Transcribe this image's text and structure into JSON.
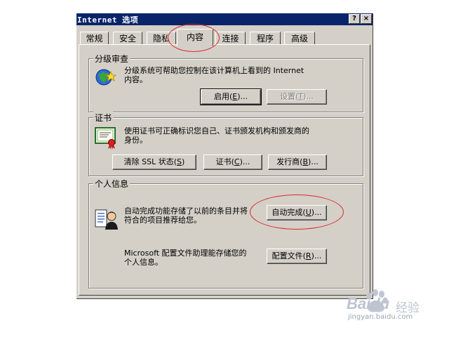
{
  "window": {
    "title": "Internet 选项",
    "help_btn": "?",
    "close_btn": "×"
  },
  "tabs": [
    {
      "label": "常规"
    },
    {
      "label": "安全"
    },
    {
      "label": "隐私"
    },
    {
      "label": "内容",
      "active": true
    },
    {
      "label": "连接"
    },
    {
      "label": "程序"
    },
    {
      "label": "高级"
    }
  ],
  "content_advisor": {
    "title": "分级审查",
    "description_line1": "分级系统可帮助您控制在该计算机上看到的 Internet",
    "description_line2": "内容。",
    "enable_button": "启用(",
    "enable_key": "E",
    "enable_tail": ")...",
    "settings_button": "设置(",
    "settings_key": "T",
    "settings_tail": ")..."
  },
  "certificates": {
    "title": "证书",
    "description_line1": "使用证书可正确标识您自己、证书颁发机构和颁发商的",
    "description_line2": "身份。",
    "clear_ssl_button": "清除 SSL 状态(",
    "clear_ssl_key": "S",
    "clear_ssl_tail": ")",
    "certificates_button": "证书(",
    "certificates_key": "C",
    "certificates_tail": ")...",
    "publishers_button": "发行商(",
    "publishers_key": "B",
    "publishers_tail": ")..."
  },
  "personal_info": {
    "title": "个人信息",
    "autocomplete_line1": "自动完成功能存储了以前的条目并将",
    "autocomplete_line2": "符合的项目推荐给您。",
    "autocomplete_button": "自动完成(",
    "autocomplete_key": "U",
    "autocomplete_tail": ")...",
    "profile_line1": "Microsoft 配置文件助理能存储您的",
    "profile_line2": "个人信息。",
    "profile_button": "配置文件(",
    "profile_key": "R",
    "profile_tail": ")..."
  },
  "watermark": {
    "brand": "Baidu",
    "suffix": "经验",
    "url": "jingyan.baidu.com"
  },
  "colors": {
    "titlebar": "#0a246a",
    "face": "#d4d0c8",
    "annotation": "#d92b2b"
  }
}
